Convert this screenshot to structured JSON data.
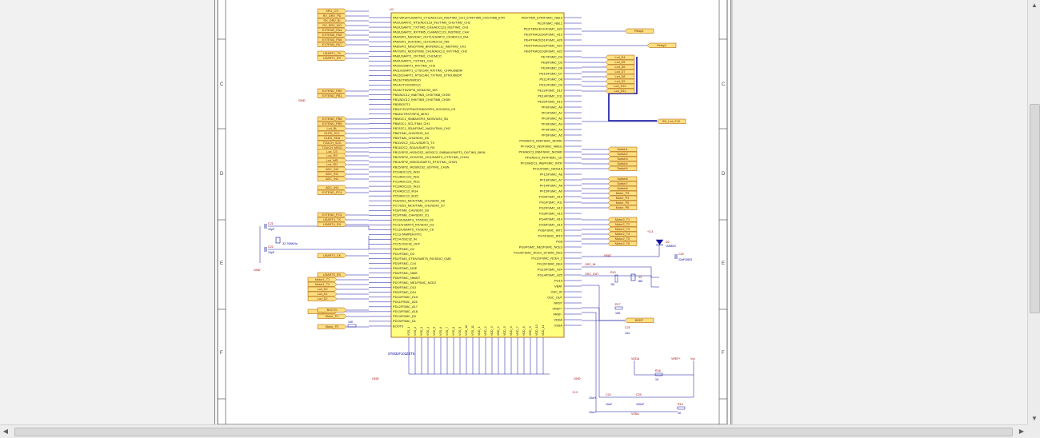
{
  "colors": {
    "wire": "#1010a0",
    "chip_fill": "#ffff80",
    "chip_stroke": "#a05000",
    "port_fill": "#ffe080",
    "port_stroke": "#a05000",
    "text_red": "#a00000",
    "text_blue": "#0000a0",
    "power_red": "#c00000"
  },
  "sheet": {
    "zone_labels_left": [
      "C",
      "D",
      "E",
      "F"
    ],
    "zone_labels_right": [
      "C",
      "D",
      "E",
      "F"
    ]
  },
  "chip": {
    "designator": "U1",
    "part_name": "STM32F103ZET6",
    "left_pins": [
      "PA0-WKUP/USART2_CTS/ADC123_IN0/TIM2_CH1_ETR/TIM5_CH1/TIM8_ETR",
      "PA1/USART2_RTS/ADC123_IN1/TIM5_CH2/TIM2_CH2",
      "PA2/USART2_TX/TIM5_CH3/ADC123_IN2/TIM2_CH3",
      "PA3/USART2_RX/TIM5_CH4/ADC123_IN3/TIM2_CH4",
      "PA4/SPI1_NSS/DAC_OUT1/USART2_CK/ADC12_IN4",
      "PA5/SPI1_SCK/DAC_OUT2/ADC12_IN5",
      "PA6/SPI1_MISO/TIM8_BKIN/ADC12_IN6/TIM3_CH1",
      "PA7/SPI1_MOSI/TIM8_CH1N/ADC12_IN7/TIM3_CH2",
      "PA8/USART1_CK/TIM1_CH1/MCO",
      "PA9/USART1_TX/TIM1_CH2",
      "PA10/USART1_RX/TIM1_CH3",
      "PA11/USART1_CTS/CAN_RX/TIM1_CH4/USBDM",
      "PA12/USART1_RTS/CAN_TX/TIM1_ETR/USBDP",
      "PA13/JTMS/SWDIO",
      "PA14/JTCK/SWCLK",
      "PA15/JTDI/SPI3_NSS/I2S3_WS",
      "PB0/ADC12_IN8/TIM3_CH3/TIM8_CH2N",
      "PB1/ADC12_IN9/TIM3_CH4/TIM8_CH3N",
      "PB2/BOOT1",
      "PB3/JTDO/TRACESWO/SPI3_SCK/I2S3_CK",
      "PB4/NJTRST/SPI3_MISO",
      "PB5/I2C1_SMBAI/SPI3_MOSI/I2S3_SD",
      "PB6/I2C1_SCL/TIM4_CH1",
      "PB7/I2C1_SDA/FSMC_NADV/TIM4_CH2",
      "PB8/TIM4_CH3/SDIO_D4",
      "PB9/TIM4_CH4/SDIO_D5",
      "PB10/I2C2_SCL/USART3_TX",
      "PB11/I2C2_SDA/USART3_RX",
      "PB12/SPI2_NSS/I2S2_WS/I2C2_SMBAI/USART3_CK/TIM1_BKIN",
      "PB13/SPI2_SCK/I2S2_CK/USART3_CTS/TIM1_CH1N",
      "PB14/SPI2_MISO/USART3_RTS/TIM1_CH2N",
      "PB15/SPI2_MOSI/I2S2_SD/TIM1_CH3N",
      "PC0/ADC123_IN10",
      "PC1/ADC123_IN11",
      "PC2/ADC123_IN12",
      "PC3/ADC123_IN13",
      "PC4/ADC12_IN14",
      "PC5/ADC12_IN15",
      "PC6/I2S2_MCK/TIM8_CH1/SDIO_D6",
      "PC7/I2S3_MCK/TIM8_CH2/SDIO_D7",
      "PC8/TIM8_CH3/SDIO_D0",
      "PC9/TIM8_CH4/SDIO_D1",
      "PC10/USART4_TX/SDIO_D2",
      "PC11/USART4_RX/SDIO_D3",
      "PC12/USART5_TX/SDIO_CK",
      "PC13-TAMPER-RTC",
      "PC14-OSC32_IN",
      "PC15-OSC32_OUT",
      "PD0/FSMC_D2",
      "PD1/FSMC_D3",
      "PD2/TIM3_ETR/USART5_RX/SDIO_CMD",
      "PD3/FSMC_CLK",
      "PD4/FSMC_NOE",
      "PD5/FSMC_NWE",
      "PD6/FSMC_NWAIT",
      "PD7/FSMC_NE1/FSMC_NCE2",
      "PD8/FSMC_D13",
      "PD9/FSMC_D14",
      "PD10/FSMC_D15",
      "PD11/FSMC_A16",
      "PD12/FSMC_A17",
      "PD13/FSMC_A18",
      "PD14/FSMC_D0",
      "PD15/FSMC_D1",
      "BOOT0"
    ],
    "right_pins": [
      "PE0/TIM4_ETR/FSMC_NBL0",
      "PE1/FSMC_NBL1",
      "PE2/TRACECK/FSMC_A23",
      "PE3/TRACED0/FSMC_A19",
      "PE4/TRACED1/FSMC_A20",
      "PE5/TRACED2/FSMC_A21",
      "PE6/TRACED3/FSMC_A22",
      "PE7/FSMC_D4",
      "PE8/FSMC_D5",
      "PE9/FSMC_D6",
      "PE10/FSMC_D7",
      "PE11/FSMC_D8",
      "PE12/FSMC_D9",
      "PE13/FSMC_D10",
      "PE14/FSMC_D11",
      "PE15/FSMC_D12",
      "PF0/FSMC_A0",
      "PF1/FSMC_A1",
      "PF2/FSMC_A2",
      "PF3/FSMC_A3",
      "PF4/FSMC_A4",
      "PF5/FSMC_A5",
      "PF6/ADC3_IN4/FSMC_NIORD",
      "PF7/ADC3_IN5/FSMC_NREG",
      "PF8/ADC3_IN6/FSMC_NIOWR",
      "PF9/ADC3_IN7/FSMC_CD",
      "PF10/ADC3_IN8/FSMC_INTR",
      "PF11/FSMC_NIOS16",
      "PF12/FSMC_A6",
      "PF13/FSMC_A7",
      "PF14/FSMC_A8",
      "PF15/FSMC_A9",
      "PG0/FSMC_A10",
      "PG1/FSMC_A11",
      "PG2/FSMC_A12",
      "PG3/FSMC_A13",
      "PG4/FSMC_A14",
      "PG5/FSMC_A15",
      "PG6/FSMC_INT2",
      "PG7/FSMC_INT3",
      "PG8",
      "PG9/FSMC_NE2/FSMC_NCE3",
      "PG10/FSMC_NCE4_1/FSMC_NE3",
      "PG11/FSMC_NCE4_2",
      "PG12/FSMC_NE4",
      "PG13/FSMC_A24",
      "PG14/FSMC_A25",
      "PG15",
      "VBAT",
      "OSC_IN",
      "OSC_OUT",
      "NRST",
      "VREF+",
      "VREF-",
      "VDDA",
      "VSSA"
    ],
    "bottom_pins": [
      "VSS_1",
      "VSS_2",
      "VSS_3",
      "VSS_4",
      "VSS_5",
      "VSS_6",
      "VSS_7",
      "VSS_8",
      "VSS_9",
      "VSS_10",
      "VSS_11",
      "VDD_1",
      "VDD_2",
      "VDD_3",
      "VDD_4",
      "VDD_5",
      "VDD_6",
      "VDD_7",
      "VDD_8",
      "VDD_9",
      "VDD_10",
      "VDD_11"
    ]
  },
  "left_ports": [
    "SPI1_CS",
    "RX_DRV_PD",
    "RX_DRV_BI",
    "RX_DRV_MO",
    "EXTEND_PA4",
    "EXTEND_PA5",
    "EXTEND_PA6",
    "EXTEND_PA7",
    "USART1_TX",
    "USART1_RX",
    "EXTEND_PB0",
    "EXTEND_PB1",
    "EXTEND_PB8",
    "EXTEND_PB9",
    "Lcd_BL",
    "OLED_SCL",
    "OLED_SDA",
    "TOUCH_SCK",
    "TOUCH_MISO",
    "Lcd_CS",
    "Lcd_RS",
    "Lcd_WR",
    "Lcd_RD",
    "ADC_IN0",
    "ADC_IN1",
    "ADC_IN2",
    "ADC_IN3",
    "EXTEND_PC4",
    "EXTEND_PC5",
    "USART4_TX",
    "USART4_RX",
    "USART4_CK",
    "USART5_RX",
    "Motor1_T1",
    "Motor1_T2",
    "Lcd_D0",
    "Lcd_D1",
    "Lcd_D2",
    "Lcd_D3",
    "Motor_P1",
    "Motor_P2",
    "BOOT0"
  ],
  "right_ports": [
    "Relay1",
    "Relay2",
    "Lcd_D4",
    "Lcd_D5",
    "Lcd_D6",
    "Lcd_D7",
    "Lcd_D8",
    "Lcd_D9",
    "Lcd_D10",
    "Lcd_D11",
    "SD_Lcd_F10",
    "Switch1",
    "Switch2",
    "Switch3",
    "Switch4",
    "Switch5",
    "Switch6",
    "Switch7",
    "Switch8",
    "Motor_P3",
    "Motor_P4",
    "Motor_P5",
    "Motor_P6",
    "Motor2_T1",
    "Motor2_T2",
    "Motor2_T3",
    "Motor2_T4",
    "Motor2_T5",
    "Motor2_T6",
    "BEEP"
  ],
  "components": {
    "c_osc32_a": "C21",
    "c_osc32_b": "C22",
    "c_osc32_val": "10pF",
    "crystal32": "32.768KHz",
    "gnd": "GND",
    "vbat_cap": "C20",
    "vbat_cap_val": "22pF/0603",
    "diode": "D2",
    "diode_part": "1N5819",
    "osc_r": "R10",
    "osc_r_val": "1M",
    "osc_y": "Y2",
    "osc_y_val": "8M",
    "reset_r": "R17",
    "reset_r_val": "10K",
    "reset_c": "C23",
    "reset_c_val": "104",
    "reset_label": "RESET",
    "vref_label": "VREF+",
    "vdda_label": "VDDA",
    "vssa_label": "VSSA",
    "vcc_label": "Vcc",
    "v33_label": "+3.3",
    "vbat_label": "VBAT",
    "bead_a": "L1",
    "bead_b": "L2",
    "bead_val": "10uH",
    "c24": "C24",
    "c25": "C25",
    "c_10uf": "10uF",
    "c_100nf": "100nF",
    "r18": "R18",
    "r19": "R19",
    "r_val": "1K",
    "boot_res": "10K",
    "osc_in": "OSC_IN",
    "osc_out": "OSC_OUT"
  },
  "scrollbars": {
    "up_arrow": "▲",
    "down_arrow": "▼",
    "left_arrow": "◀",
    "right_arrow": "▶"
  }
}
